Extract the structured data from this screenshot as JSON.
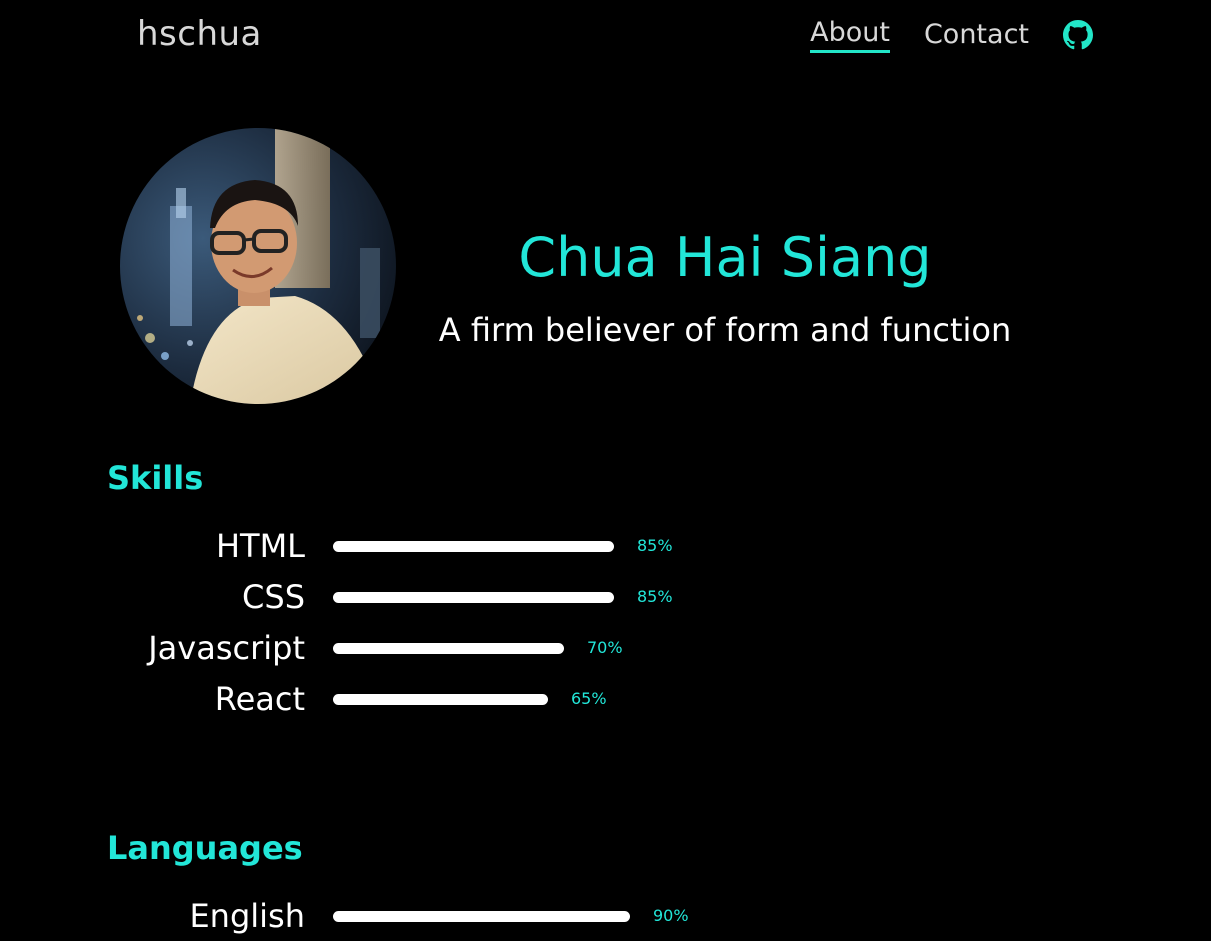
{
  "brand": "hschua",
  "nav": {
    "about": "About",
    "contact": "Contact",
    "github_icon": "github-icon"
  },
  "hero": {
    "name": "Chua Hai Siang",
    "tagline": "A firm believer of form and function",
    "avatar": "profile photo"
  },
  "skills": {
    "title": "Skills",
    "items": [
      {
        "label": "HTML",
        "percent": 85,
        "text": "85%"
      },
      {
        "label": "CSS",
        "percent": 85,
        "text": "85%"
      },
      {
        "label": "Javascript",
        "percent": 70,
        "text": "70%"
      },
      {
        "label": "React",
        "percent": 65,
        "text": "65%"
      }
    ]
  },
  "languages": {
    "title": "Languages",
    "items": [
      {
        "label": "English",
        "percent": 90,
        "text": "90%"
      }
    ]
  },
  "colors": {
    "accent": "#22e6d8",
    "background": "#000000",
    "text": "#ffffff"
  }
}
